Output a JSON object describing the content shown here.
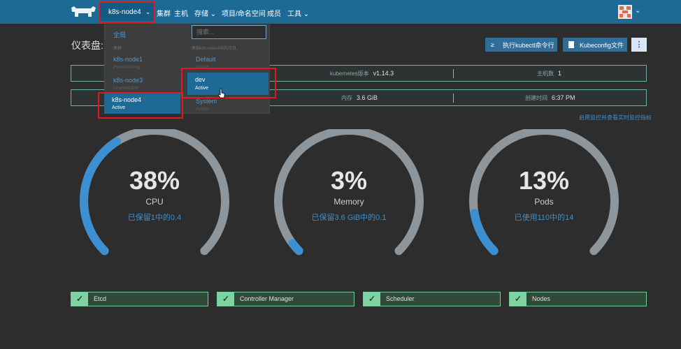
{
  "header": {
    "cluster_selector": "k8s-node4",
    "nav": [
      "集群",
      "主机",
      "存储",
      "项目/命名空间",
      "成员",
      "工具"
    ]
  },
  "page": {
    "title": "仪表盘: k",
    "kubectl_button": "执行kubectl命令行",
    "kubeconfig_button": "Kubeconfig文件",
    "more_button": "⋮"
  },
  "info_row1": {
    "k8s_version_label": "kubernetes版本",
    "k8s_version": "v1.14.3",
    "hosts_label": "主机数",
    "hosts": "1"
  },
  "info_row2": {
    "memory_label": "内存",
    "memory": "3.6 GiB",
    "created_label": "创建时间",
    "created": "6:37 PM"
  },
  "monitor_link": "启用监控并查看实时监控指标",
  "dropdown": {
    "global": "全局",
    "search_placeholder": "搜索...",
    "cluster_header": "集群",
    "project_header": "集群k8s-node4中的项目。",
    "clusters": [
      {
        "name": "k8s-node1",
        "state": "Provisioning"
      },
      {
        "name": "k8s-node3",
        "state": "Unavailable"
      },
      {
        "name": "k8s-node4",
        "state": "Active"
      }
    ],
    "projects": [
      {
        "name": "Default",
        "state": "Active"
      },
      {
        "name": "dev",
        "state": "Active"
      },
      {
        "name": "System",
        "state": "Active"
      }
    ]
  },
  "gauges": [
    {
      "value": "38%",
      "fraction": 0.38,
      "label": "CPU",
      "sub": "已保留1中的0.4"
    },
    {
      "value": "3%",
      "fraction": 0.03,
      "label": "Memory",
      "sub": "已保留3.6 GiB中的0.1"
    },
    {
      "value": "13%",
      "fraction": 0.13,
      "label": "Pods",
      "sub": "已使用110中的14"
    }
  ],
  "components": [
    "Etcd",
    "Controller Manager",
    "Scheduler",
    "Nodes"
  ],
  "colors": {
    "accent": "#1d6a96",
    "gauge_fill": "#3c8fd0",
    "gauge_track": "#8e969b",
    "healthy": "#7fd3a3",
    "annotation": "#e0181f"
  }
}
